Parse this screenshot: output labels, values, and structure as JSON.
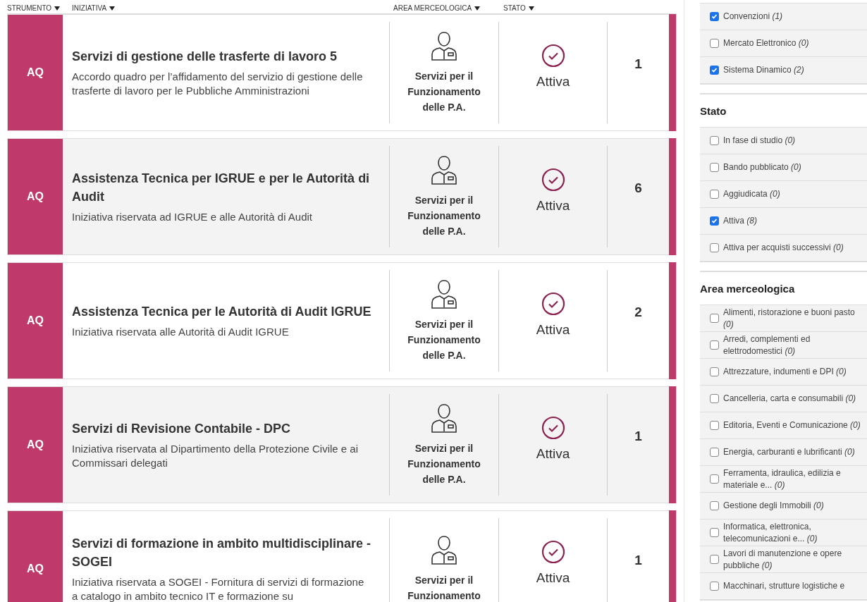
{
  "table": {
    "columns": [
      {
        "label": "STRUMENTO"
      },
      {
        "label": "INIZIATIVA"
      },
      {
        "label": "AREA MERCEOLOGICA"
      },
      {
        "label": "STATO"
      }
    ],
    "rows": [
      {
        "tool": "AQ",
        "title": "Servizi di gestione delle trasferte di lavoro 5",
        "description": "Accordo quadro per l’affidamento del servizio di gestione delle trasferte di lavoro per le Pubbliche Amministrazioni",
        "area": "Servizi per il Funzionamento delle P.A.",
        "status": "Attiva",
        "count": "1",
        "selected": false
      },
      {
        "tool": "AQ",
        "title": "Assistenza Tecnica per IGRUE e per le Autorità di Audit",
        "description": "Iniziativa riservata ad IGRUE e alle Autorità di Audit",
        "area": "Servizi per il Funzionamento delle P.A.",
        "status": "Attiva",
        "count": "6",
        "selected": true
      },
      {
        "tool": "AQ",
        "title": "Assistenza Tecnica per le Autorità di Audit IGRUE",
        "description": "Iniziativa riservata alle Autorità di Audit IGRUE",
        "area": "Servizi per il Funzionamento delle P.A.",
        "status": "Attiva",
        "count": "2",
        "selected": false
      },
      {
        "tool": "AQ",
        "title": "Servizi di Revisione Contabile - DPC",
        "description": "Iniziativa riservata al Dipartimento della Protezione Civile e ai Commissari delegati",
        "area": "Servizi per il Funzionamento delle P.A.",
        "status": "Attiva",
        "count": "1",
        "selected": true
      },
      {
        "tool": "AQ",
        "title": "Servizi di formazione in ambito multidisciplinare - SOGEI",
        "description": "Iniziativa riservata a SOGEI - Fornitura di servizi di formazione a catalogo in ambito tecnico IT e formazione su",
        "area": "Servizi per il Funzionamento",
        "status": "Attiva",
        "count": "1",
        "selected": false
      }
    ]
  },
  "filters": [
    {
      "items": [
        {
          "label": "Convenzioni",
          "count": "(1)",
          "checked": true
        },
        {
          "label": "Mercato Elettronico",
          "count": "(0)",
          "checked": false
        },
        {
          "label": "Sistema Dinamico",
          "count": "(2)",
          "checked": true
        }
      ]
    },
    {
      "title": "Stato",
      "items": [
        {
          "label": "In fase di studio",
          "count": "(0)",
          "checked": false
        },
        {
          "label": "Bando pubblicato",
          "count": "(0)",
          "checked": false
        },
        {
          "label": "Aggiudicata",
          "count": "(0)",
          "checked": false
        },
        {
          "label": "Attiva",
          "count": "(8)",
          "checked": true
        },
        {
          "label": "Attiva per acquisti successivi",
          "count": "(0)",
          "checked": false
        }
      ]
    },
    {
      "title": "Area merceologica",
      "items": [
        {
          "label": "Alimenti, ristorazione e buoni pasto",
          "count": "(0)",
          "checked": false
        },
        {
          "label": "Arredi, complementi ed elettrodomestici",
          "count": "(0)",
          "checked": false
        },
        {
          "label": "Attrezzature, indumenti e DPI",
          "count": "(0)",
          "checked": false
        },
        {
          "label": "Cancelleria, carta e consumabili",
          "count": "(0)",
          "checked": false
        },
        {
          "label": "Editoria, Eventi e Comunicazione",
          "count": "(0)",
          "checked": false
        },
        {
          "label": "Energia, carburanti e lubrificanti",
          "count": "(0)",
          "checked": false
        },
        {
          "label": "Ferramenta, idraulica, edilizia e materiale e...",
          "count": "(0)",
          "checked": false
        },
        {
          "label": "Gestione degli Immobili",
          "count": "(0)",
          "checked": false
        },
        {
          "label": "Informatica, elettronica, telecomunicazioni e...",
          "count": "(0)",
          "checked": false
        },
        {
          "label": "Lavori di manutenzione e opere pubbliche",
          "count": "(0)",
          "checked": false
        },
        {
          "label": "Macchinari, strutture logistiche e",
          "checked": false
        }
      ]
    }
  ]
}
